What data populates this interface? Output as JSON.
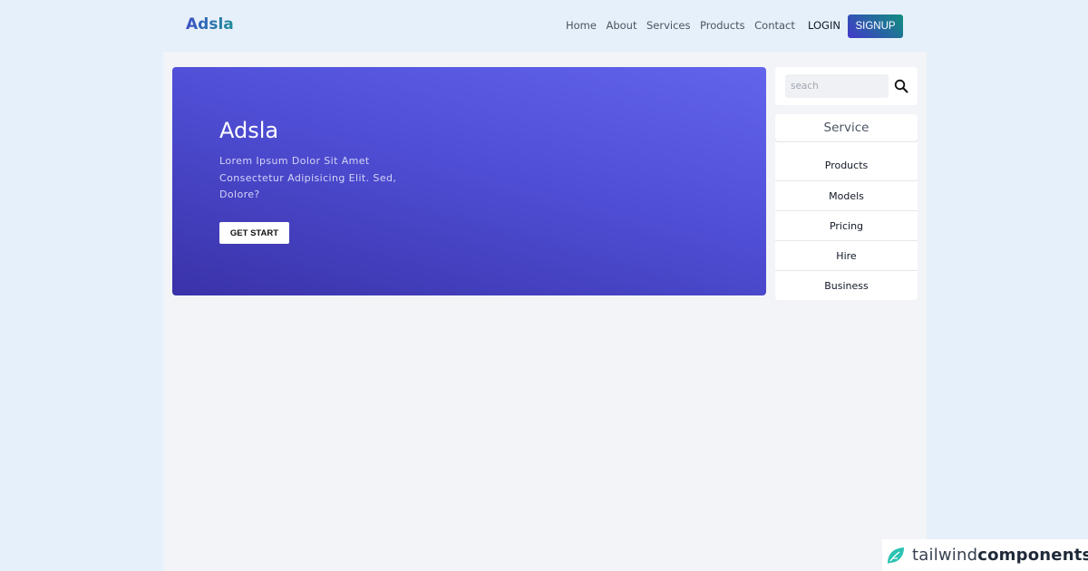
{
  "header": {
    "logo": "Adsla",
    "nav": [
      "Home",
      "About",
      "Services",
      "Products",
      "Contact"
    ],
    "login_label": "LOGIN",
    "signup_label": "SIGNUP"
  },
  "hero": {
    "title": "Adsla",
    "text": "Lorem Ipsum Dolor Sit Amet Consectetur Adipisicing Elit. Sed, Dolore?",
    "button_label": "GET START"
  },
  "sidebar": {
    "search_placeholder": "seach",
    "search_icon": "search-icon",
    "service_title": "Service",
    "items": [
      "Products",
      "Models",
      "Pricing",
      "Hire",
      "Business"
    ]
  },
  "badge": {
    "light": "tailwind",
    "bold": "components"
  },
  "colors": {
    "brand": "#4338ca",
    "accent": "#0f8f7f",
    "background": "#e6f0fa"
  }
}
